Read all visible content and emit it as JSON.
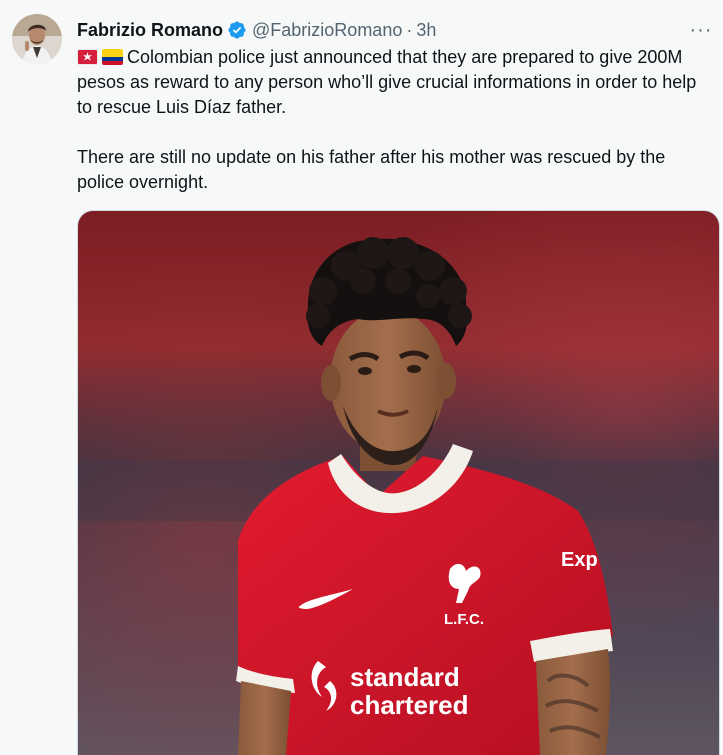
{
  "author": {
    "name": "Fabrizio Romano",
    "handle": "@FabrizioRomano",
    "separator": "·",
    "time": "3h",
    "verified": true
  },
  "tweet": {
    "paragraph1": "Colombian police just announced that they are prepared to give 200M pesos as reward to any person who’ll give crucial informations in order to help to rescue Luis Díaz father.",
    "paragraph2": "There are still no update on his father after his mother was rescued by the police overnight.",
    "emoji": [
      "siren-emoji",
      "colombia-flag-emoji"
    ]
  },
  "media": {
    "shirt_sponsor_line1": "standard",
    "shirt_sponsor_line2": "chartered",
    "club_crest_text": "L.F.C.",
    "sleeve_text": "Exp"
  },
  "menu": {
    "more_label": "···"
  },
  "colors": {
    "verified_blue": "#1d9bf0",
    "text": "#0f1419",
    "secondary_text": "#536471",
    "shirt_red": "#d5142a"
  }
}
